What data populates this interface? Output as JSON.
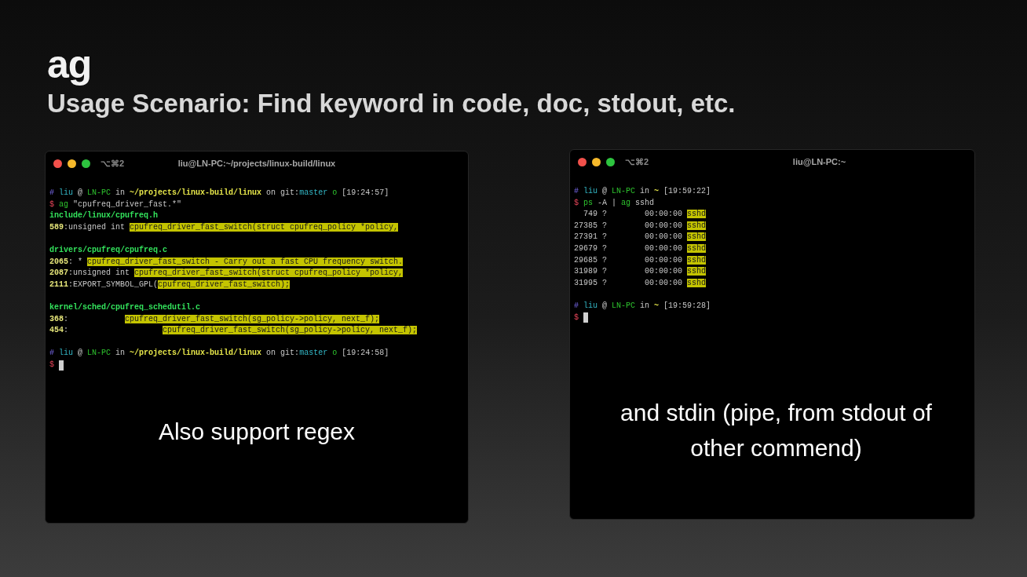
{
  "slide": {
    "title": "ag",
    "subtitle": "Usage Scenario: Find keyword in code, doc, stdout, etc."
  },
  "terminals": [
    {
      "shortcut": "⌥⌘2",
      "title": "liu@LN-PC:~/projects/linux-build/linux",
      "cursor": true,
      "caption": "Also support regex",
      "blocks": [
        [
          [
            {
              "text": "# ",
              "kind": "hash"
            },
            {
              "text": "liu",
              "kind": "user"
            },
            {
              "text": " @ ",
              "kind": "plain"
            },
            {
              "text": "LN-PC",
              "kind": "host"
            },
            {
              "text": " in ",
              "kind": "plain"
            },
            {
              "text": "~/projects/linux-build/linux",
              "kind": "path"
            },
            {
              "text": " on git:",
              "kind": "plain"
            },
            {
              "text": "master",
              "kind": "branch"
            },
            {
              "text": " o",
              "kind": "status"
            },
            {
              "text": " [19:24:57]",
              "kind": "plain"
            }
          ],
          [
            {
              "text": "$ ",
              "kind": "dollar"
            },
            {
              "text": "ag",
              "kind": "cmd"
            },
            {
              "text": " \"cpufreq_driver_fast.*\"",
              "kind": "plain"
            }
          ],
          [
            {
              "text": "include/linux/cpufreq.h",
              "kind": "file"
            }
          ],
          [
            {
              "text": "589",
              "kind": "lineno"
            },
            {
              "text": ":unsigned int ",
              "kind": "plain"
            },
            {
              "text": "cpufreq_driver_fast_switch(struct cpufreq_policy *policy,",
              "kind": "match"
            }
          ]
        ],
        [
          [
            {
              "text": "drivers/cpufreq/cpufreq.c",
              "kind": "file"
            }
          ],
          [
            {
              "text": "2065",
              "kind": "lineno"
            },
            {
              "text": ": * ",
              "kind": "plain"
            },
            {
              "text": "cpufreq_driver_fast_switch - Carry out a fast CPU frequency switch.",
              "kind": "match"
            }
          ],
          [
            {
              "text": "2087",
              "kind": "lineno"
            },
            {
              "text": ":unsigned int ",
              "kind": "plain"
            },
            {
              "text": "cpufreq_driver_fast_switch(struct cpufreq_policy *policy,",
              "kind": "match"
            }
          ],
          [
            {
              "text": "2111",
              "kind": "lineno"
            },
            {
              "text": ":EXPORT_SYMBOL_GPL(",
              "kind": "plain"
            },
            {
              "text": "cpufreq_driver_fast_switch);",
              "kind": "match"
            }
          ]
        ],
        [
          [
            {
              "text": "kernel/sched/cpufreq_schedutil.c",
              "kind": "file"
            }
          ],
          [
            {
              "text": "368",
              "kind": "lineno"
            },
            {
              "text": ":            ",
              "kind": "plain"
            },
            {
              "text": "cpufreq_driver_fast_switch(sg_policy->policy, next_f);",
              "kind": "match"
            }
          ],
          [
            {
              "text": "454",
              "kind": "lineno"
            },
            {
              "text": ":                    ",
              "kind": "plain"
            },
            {
              "text": "cpufreq_driver_fast_switch(sg_policy->policy, next_f);",
              "kind": "match"
            }
          ]
        ],
        [
          [
            {
              "text": "# ",
              "kind": "hash"
            },
            {
              "text": "liu",
              "kind": "user"
            },
            {
              "text": " @ ",
              "kind": "plain"
            },
            {
              "text": "LN-PC",
              "kind": "host"
            },
            {
              "text": " in ",
              "kind": "plain"
            },
            {
              "text": "~/projects/linux-build/linux",
              "kind": "path"
            },
            {
              "text": " on git:",
              "kind": "plain"
            },
            {
              "text": "master",
              "kind": "branch"
            },
            {
              "text": " o",
              "kind": "status"
            },
            {
              "text": " [19:24:58]",
              "kind": "plain"
            }
          ],
          [
            {
              "text": "$ ",
              "kind": "dollar"
            }
          ]
        ]
      ]
    },
    {
      "shortcut": "⌥⌘2",
      "title": "liu@LN-PC:~",
      "cursor": true,
      "caption": "and stdin (pipe, from stdout of other commend)",
      "blocks": [
        [
          [
            {
              "text": "# ",
              "kind": "hash"
            },
            {
              "text": "liu",
              "kind": "user"
            },
            {
              "text": " @ ",
              "kind": "plain"
            },
            {
              "text": "LN-PC",
              "kind": "host"
            },
            {
              "text": " in ",
              "kind": "plain"
            },
            {
              "text": "~",
              "kind": "path"
            },
            {
              "text": " [19:59:22]",
              "kind": "plain"
            }
          ],
          [
            {
              "text": "$ ",
              "kind": "dollar"
            },
            {
              "text": "ps",
              "kind": "cmd"
            },
            {
              "text": " -A | ",
              "kind": "plain"
            },
            {
              "text": "ag",
              "kind": "cmd"
            },
            {
              "text": " sshd",
              "kind": "plain"
            }
          ],
          [
            {
              "text": "  749 ?        00:00:00 ",
              "kind": "plain"
            },
            {
              "text": "sshd",
              "kind": "match"
            }
          ],
          [
            {
              "text": "27385 ?        00:00:00 ",
              "kind": "plain"
            },
            {
              "text": "sshd",
              "kind": "match"
            }
          ],
          [
            {
              "text": "27391 ?        00:00:00 ",
              "kind": "plain"
            },
            {
              "text": "sshd",
              "kind": "match"
            }
          ],
          [
            {
              "text": "29679 ?        00:00:00 ",
              "kind": "plain"
            },
            {
              "text": "sshd",
              "kind": "match"
            }
          ],
          [
            {
              "text": "29685 ?        00:00:00 ",
              "kind": "plain"
            },
            {
              "text": "sshd",
              "kind": "match"
            }
          ],
          [
            {
              "text": "31989 ?        00:00:00 ",
              "kind": "plain"
            },
            {
              "text": "sshd",
              "kind": "match"
            }
          ],
          [
            {
              "text": "31995 ?        00:00:00 ",
              "kind": "plain"
            },
            {
              "text": "sshd",
              "kind": "match"
            }
          ]
        ],
        [
          [
            {
              "text": "# ",
              "kind": "hash"
            },
            {
              "text": "liu",
              "kind": "user"
            },
            {
              "text": " @ ",
              "kind": "plain"
            },
            {
              "text": "LN-PC",
              "kind": "host"
            },
            {
              "text": " in ",
              "kind": "plain"
            },
            {
              "text": "~",
              "kind": "path"
            },
            {
              "text": " [19:59:28]",
              "kind": "plain"
            }
          ],
          [
            {
              "text": "$ ",
              "kind": "dollar"
            }
          ]
        ]
      ]
    }
  ]
}
